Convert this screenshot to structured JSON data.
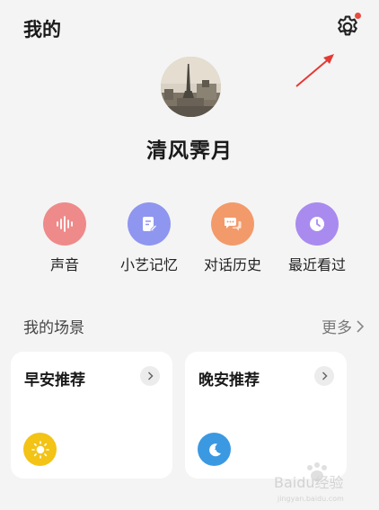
{
  "header": {
    "title": "我的"
  },
  "profile": {
    "username": "清风霁月"
  },
  "shortcuts": [
    {
      "label": "声音",
      "icon": "sound-wave-icon",
      "color": "#ef8a8a"
    },
    {
      "label": "小艺记忆",
      "icon": "memo-edit-icon",
      "color": "#8f96ef"
    },
    {
      "label": "对话历史",
      "icon": "chat-bubbles-icon",
      "color": "#f39a6b"
    },
    {
      "label": "最近看过",
      "icon": "clock-icon",
      "color": "#a98bef"
    }
  ],
  "scenes": {
    "title": "我的场景",
    "more_label": "更多",
    "cards": [
      {
        "title": "早安推荐",
        "icon": "sun-icon",
        "color": "#f3c315"
      },
      {
        "title": "晚安推荐",
        "icon": "moon-sleep-icon",
        "color": "#3b99e2"
      }
    ]
  },
  "colors": {
    "notification_dot": "#e84a3f",
    "background": "#f4f4f4",
    "card": "#ffffff"
  },
  "watermark": {
    "text": "Baidu经验"
  }
}
